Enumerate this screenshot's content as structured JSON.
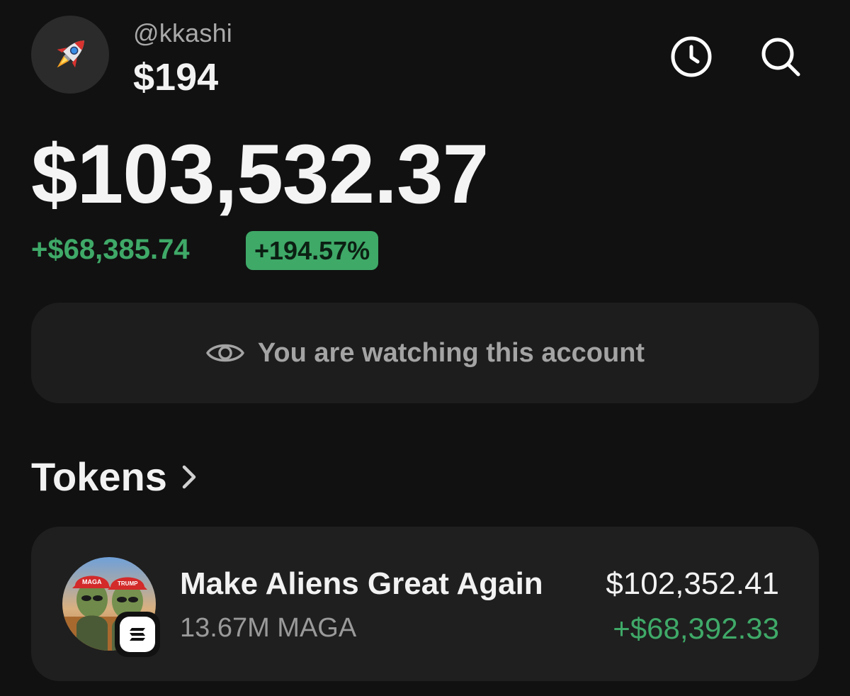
{
  "profile": {
    "avatar_icon": "rocket-icon",
    "handle": "@kkashi",
    "balance_small": "$194"
  },
  "header": {
    "history_icon": "clock-icon",
    "search_icon": "search-icon"
  },
  "portfolio": {
    "balance": "$103,532.37",
    "change_amount": "+$68,385.74",
    "change_percent": "+194.57%",
    "positive_color": "#3fa968"
  },
  "watch_banner": {
    "icon": "eye-icon",
    "text": "You are watching this account"
  },
  "tokens": {
    "title": "Tokens",
    "chevron_icon": "chevron-right-icon",
    "items": [
      {
        "name": "Make Aliens Great Again",
        "amount": "13.67M MAGA",
        "value": "$102,352.41",
        "change": "+$68,392.33",
        "image": "token-avatar-image",
        "chain_icon": "solana-icon",
        "hat_left_text": "MAGA",
        "hat_right_text": "TRUMP"
      }
    ]
  }
}
